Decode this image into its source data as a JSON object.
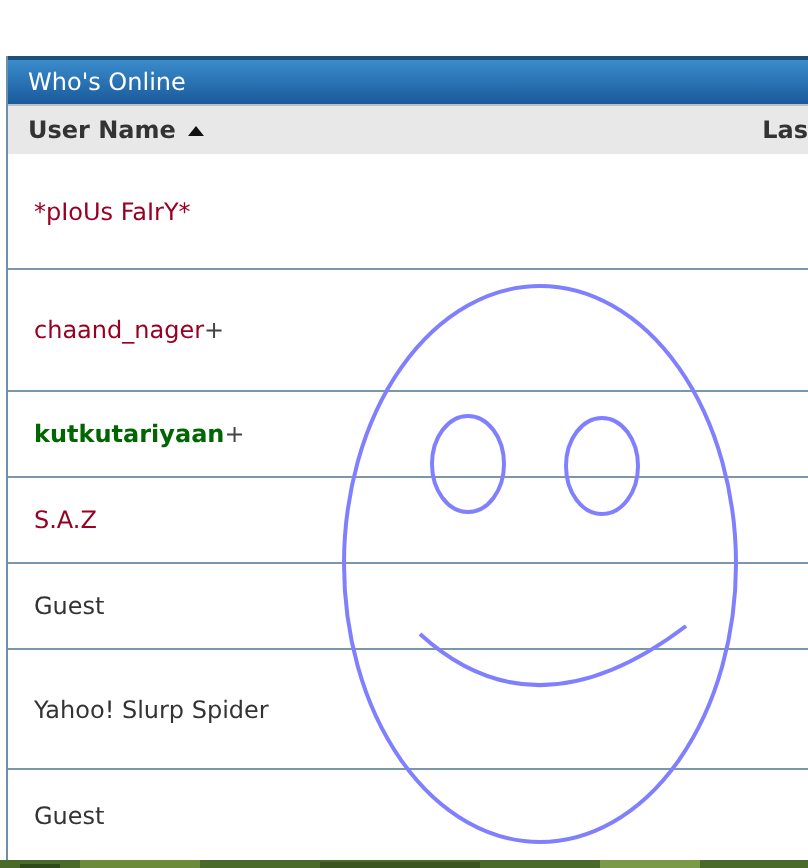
{
  "panel": {
    "title": "Who's Online"
  },
  "table": {
    "columns": [
      {
        "label": "User Name",
        "sorted": true
      },
      {
        "label": "Las"
      }
    ],
    "rows": [
      {
        "name": "*pIoUs FaIrY*",
        "color": "#990022",
        "bold": false
      },
      {
        "name": "chaand_nager",
        "suffix": "+",
        "color": "#990022",
        "bold": false
      },
      {
        "name": "kutkutariyaan",
        "suffix": "+",
        "color": "#006600",
        "bold": true
      },
      {
        "name": "S.A.Z",
        "color": "#990022",
        "bold": false
      },
      {
        "name": "Guest",
        "color": "#333333",
        "bold": false
      },
      {
        "name": "Yahoo! Slurp Spider",
        "color": "#333333",
        "bold": false
      },
      {
        "name": "Guest",
        "color": "#333333",
        "bold": false
      }
    ]
  }
}
